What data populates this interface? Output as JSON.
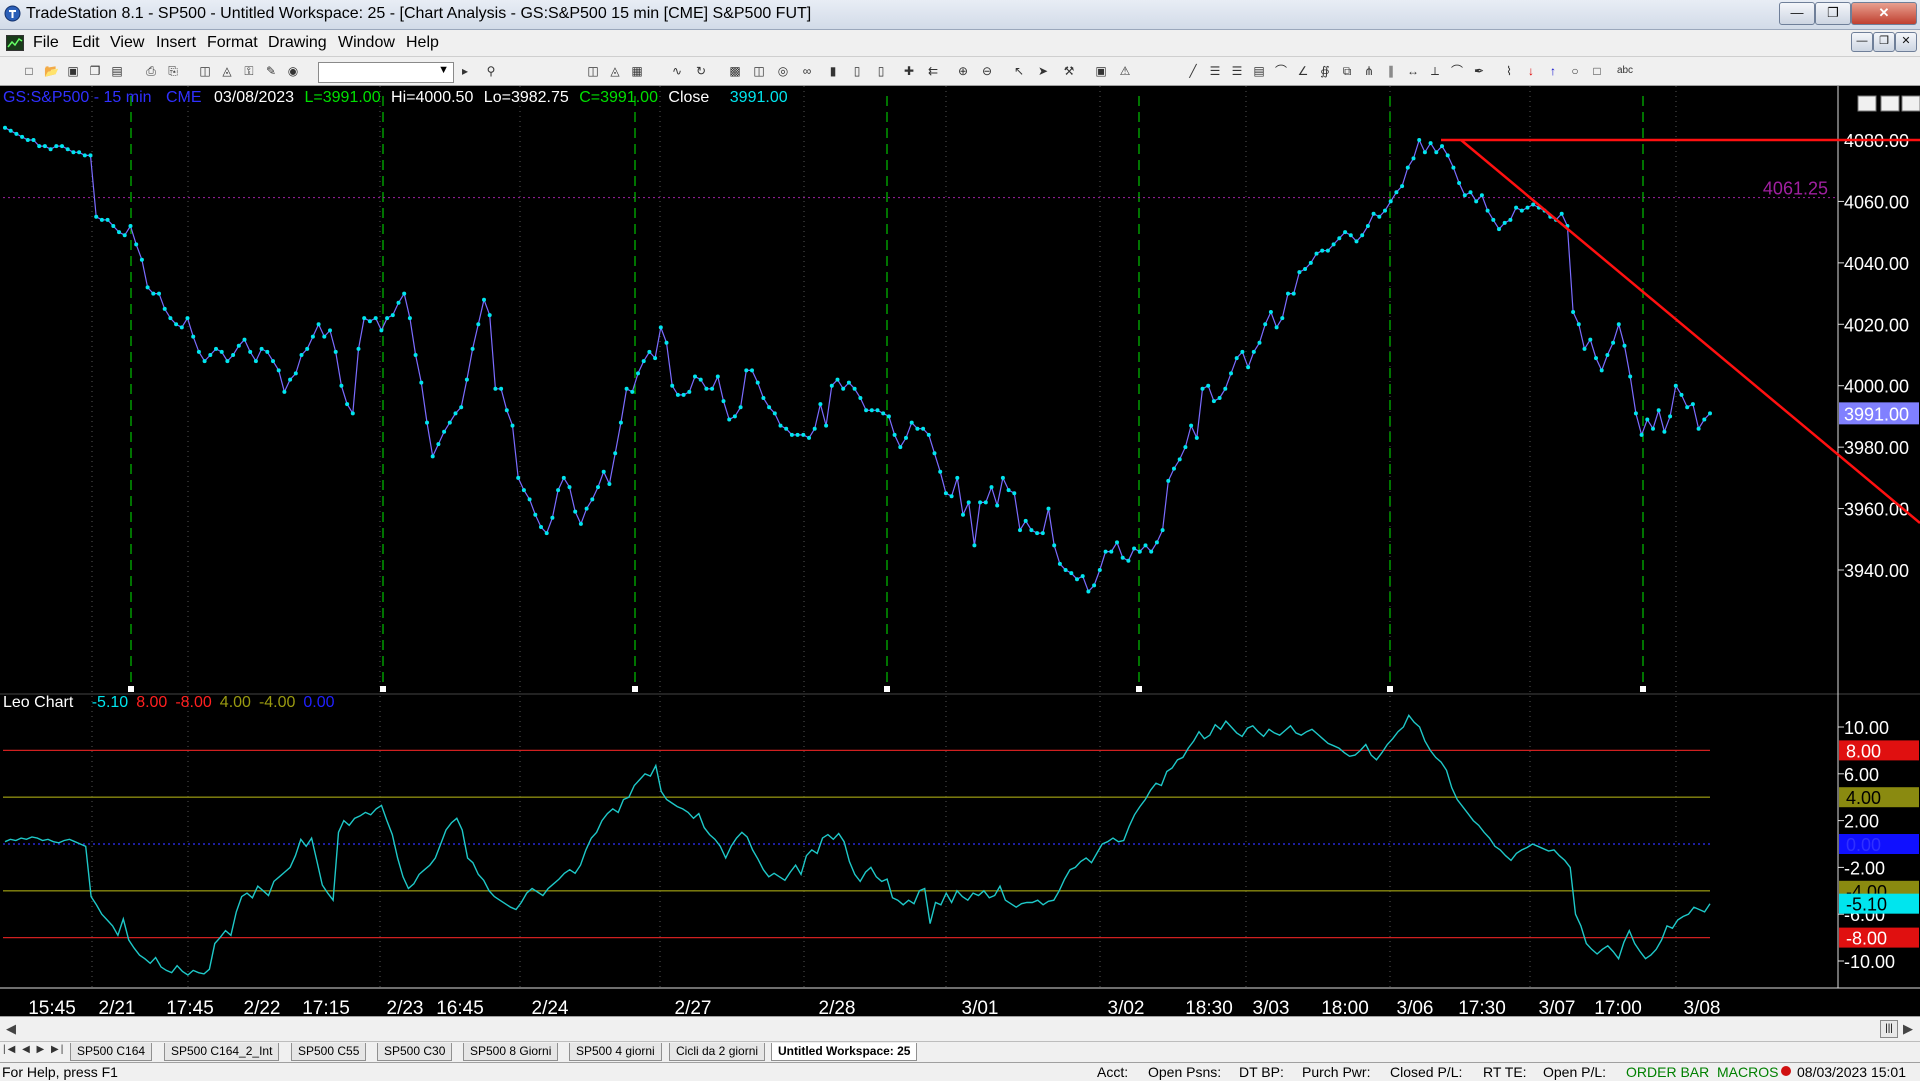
{
  "window": {
    "title": "TradeStation 8.1 - SP500 - Untitled Workspace:  25 - [Chart Analysis - GS:S&P500  15 min  [CME] S&P500 FUT]"
  },
  "menu": [
    "File",
    "Edit",
    "View",
    "Insert",
    "Format",
    "Drawing",
    "Window",
    "Help"
  ],
  "header": {
    "symbol": "GS:S&P500 - 15 min",
    "exchange": "CME",
    "date": "03/08/2023",
    "last": "L=3991.00",
    "high": "Hi=4000.50",
    "low": "Lo=3982.75",
    "close": "C=3991.00",
    "close_label": "Close",
    "close_value": "3991.00"
  },
  "indicator": {
    "name": "Leo Chart",
    "values": [
      {
        "text": "-5.10",
        "color": "#00e5ee"
      },
      {
        "text": "8.00",
        "color": "#ff2020"
      },
      {
        "text": "-8.00",
        "color": "#ff2020"
      },
      {
        "text": "4.00",
        "color": "#9a9a10"
      },
      {
        "text": "-4.00",
        "color": "#9a9a10"
      },
      {
        "text": "0.00",
        "color": "#2020ff"
      }
    ]
  },
  "colors": {
    "price_line": "#7b6cff",
    "price_dots": "#00e5ee",
    "trendline": "#ff1010",
    "session_lines": "#00c000",
    "osc_line": "#1ec8c8",
    "level_8": "#d02020",
    "level_4": "#8a8a10",
    "level_0": "#3030ff",
    "ref_level": "#a020a0"
  },
  "chart_data": [
    {
      "type": "line",
      "title": "GS:S&P500 - 15 min",
      "y_axis_ticks": [
        4080,
        4060,
        4040,
        4020,
        4000,
        3980,
        3960,
        3940
      ],
      "y_axis_labels": [
        "4080.00",
        "4060.00",
        "4040.00",
        "4020.00",
        "4000.00",
        "3980.00",
        "3960.00",
        "3940.00"
      ],
      "ylim": [
        3930,
        4090
      ],
      "x_axis_labels": [
        "15:45",
        "2/21",
        "17:45",
        "2/22",
        "17:15",
        "2/23",
        "16:45",
        "2/24",
        "2/27",
        "2/28",
        "3/01",
        "3/02",
        "18:30",
        "3/03",
        "18:00",
        "3/06",
        "17:30",
        "3/07",
        "17:00",
        "3/08"
      ],
      "reference_level": {
        "value": 4061.25,
        "label": "4061.25"
      },
      "last_value_label": "3991.00",
      "series": [
        {
          "values": [
            4084,
            4083,
            4082,
            4081,
            4080,
            4080,
            4078,
            4078,
            4077,
            4078,
            4078,
            4077,
            4076,
            4076,
            4075,
            4075,
            4055,
            4054,
            4054,
            4052,
            4050,
            4049,
            4052,
            4046,
            4041,
            4032,
            4030,
            4030,
            4025,
            4022,
            4020,
            4019,
            4022,
            4016,
            4011,
            4008,
            4010,
            4012,
            4011,
            4008,
            4010,
            4013,
            4015,
            4011,
            4008,
            4012,
            4011,
            4008,
            4005,
            3998,
            4002,
            4004,
            4010,
            4012,
            4016,
            4020,
            4016,
            4018,
            4011,
            4000,
            3994,
            3991,
            4012,
            4022,
            4021,
            4022,
            4018,
            4022,
            4023,
            4027,
            4030,
            4022,
            4010,
            4001,
            3988,
            3977,
            3981,
            3985,
            3988,
            3991,
            3993,
            4002,
            4012,
            4020,
            4028,
            4023,
            3999,
            3999,
            3992,
            3987,
            3970,
            3966,
            3963,
            3958,
            3954,
            3952,
            3957,
            3966,
            3970,
            3967,
            3959,
            3955,
            3960,
            3963,
            3967,
            3972,
            3968,
            3978,
            3988,
            3999,
            3998,
            4004,
            4008,
            4011,
            4009,
            4019,
            4014,
            4000,
            3997,
            3997,
            3998,
            4003,
            4002,
            3999,
            3999,
            4003,
            3995,
            3989,
            3990,
            3993,
            4005,
            4005,
            4001,
            3996,
            3993,
            3991,
            3987,
            3986,
            3984,
            3984,
            3984,
            3983,
            3986,
            3994,
            3987,
            4000,
            4002,
            3999,
            4001,
            3999,
            3996,
            3992,
            3992,
            3992,
            3991,
            3990,
            3984,
            3980,
            3983,
            3988,
            3986,
            3986,
            3984,
            3978,
            3972,
            3965,
            3964,
            3970,
            3958,
            3962,
            3948,
            3962,
            3962,
            3967,
            3961,
            3970,
            3966,
            3965,
            3953,
            3956,
            3953,
            3952,
            3952,
            3960,
            3948,
            3942,
            3940,
            3939,
            3937,
            3938,
            3933,
            3935,
            3940,
            3946,
            3946,
            3949,
            3944,
            3943,
            3947,
            3946,
            3948,
            3946,
            3949,
            3953,
            3969,
            3973,
            3976,
            3980,
            3987,
            3983,
            3999,
            4000,
            3995,
            3996,
            3999,
            4004,
            4009,
            4011,
            4006,
            4011,
            4014,
            4020,
            4024,
            4019,
            4022,
            4030,
            4030,
            4037,
            4038,
            4040,
            4043,
            4044,
            4044,
            4046,
            4048,
            4050,
            4049,
            4047,
            4049,
            4052,
            4056,
            4055,
            4057,
            4060,
            4063,
            4065,
            4071,
            4074,
            4080,
            4076,
            4079,
            4076,
            4078,
            4075,
            4071,
            4066,
            4062,
            4063,
            4060,
            4062,
            4057,
            4054,
            4051,
            4053,
            4054,
            4058,
            4057,
            4058,
            4059,
            4058,
            4057,
            4055,
            4054,
            4056,
            4052,
            4024,
            4020,
            4012,
            4015,
            4009,
            4005,
            4010,
            4014,
            4020,
            4013,
            4003,
            3991,
            3984,
            3989,
            3986,
            3992,
            3985,
            3990,
            4000,
            3997,
            3993,
            3994,
            3986,
            3989,
            3991
          ]
        }
      ]
    },
    {
      "type": "line",
      "title": "Leo Chart",
      "y_axis_ticks": [
        10,
        6,
        2,
        -2,
        -6,
        -10
      ],
      "y_axis_labels": [
        "10.00",
        "6.00",
        "2.00",
        "-2.00",
        "-6.00",
        "-10.00"
      ],
      "ylim": [
        -12,
        12
      ],
      "levels": [
        {
          "value": 8,
          "label": "8.00"
        },
        {
          "value": 4,
          "label": "4.00"
        },
        {
          "value": 0,
          "label": "0.00"
        },
        {
          "value": -4,
          "label": "-4.00"
        },
        {
          "value": -8,
          "label": "-8.00"
        }
      ],
      "last_value_label": "-5.10",
      "series": [
        {
          "values": [
            0.2,
            0.4,
            0.3,
            0.5,
            0.4,
            0.6,
            0.5,
            0.3,
            0.4,
            0.2,
            0.1,
            0.3,
            0.4,
            0.2,
            0.0,
            -0.2,
            -4.5,
            -5.2,
            -6.0,
            -6.5,
            -7.0,
            -7.8,
            -6.4,
            -8.2,
            -8.9,
            -9.5,
            -9.8,
            -10.2,
            -9.7,
            -10.5,
            -10.8,
            -11.0,
            -10.4,
            -10.9,
            -11.2,
            -10.8,
            -11.0,
            -11.1,
            -10.7,
            -8.5,
            -8.0,
            -7.4,
            -7.8,
            -5.8,
            -4.5,
            -4.2,
            -4.6,
            -3.6,
            -4.0,
            -4.4,
            -3.2,
            -2.8,
            -2.4,
            -2.0,
            -1.0,
            0.4,
            -0.2,
            0.5,
            -1.5,
            -3.5,
            -4.2,
            -4.8,
            1.0,
            2.0,
            1.6,
            2.2,
            2.4,
            2.7,
            2.5,
            3.0,
            3.3,
            2.0,
            0.8,
            -1.2,
            -2.8,
            -3.8,
            -3.4,
            -2.6,
            -2.2,
            -1.8,
            -1.2,
            0.0,
            1.2,
            1.8,
            2.2,
            1.2,
            -1.2,
            -1.6,
            -2.6,
            -3.1,
            -4.0,
            -4.5,
            -4.8,
            -5.1,
            -5.4,
            -5.6,
            -5.0,
            -4.2,
            -3.8,
            -4.1,
            -4.4,
            -3.8,
            -3.4,
            -3.0,
            -2.5,
            -2.2,
            -2.5,
            -1.8,
            -0.5,
            0.5,
            1.0,
            2.0,
            2.6,
            3.0,
            2.7,
            3.8,
            4.0,
            5.0,
            5.5,
            6.0,
            5.8,
            6.7,
            4.5,
            3.8,
            3.5,
            3.2,
            3.0,
            2.7,
            2.2,
            2.6,
            1.4,
            0.8,
            0.4,
            -0.2,
            -1.2,
            -0.2,
            0.5,
            1.0,
            0.6,
            -0.5,
            -1.3,
            -2.2,
            -2.8,
            -2.5,
            -2.8,
            -3.1,
            -2.4,
            -1.8,
            -2.6,
            -1.0,
            -0.5,
            -0.8,
            0.5,
            0.8,
            0.4,
            0.9,
            0.2,
            -1.5,
            -2.6,
            -3.2,
            -2.4,
            -2.0,
            -2.8,
            -3.2,
            -3.0,
            -4.6,
            -4.8,
            -5.2,
            -4.8,
            -5.1,
            -4.0,
            -3.8,
            -6.8,
            -5.0,
            -5.2,
            -4.2,
            -5.0,
            -4.0,
            -4.5,
            -4.8,
            -4.2,
            -4.4,
            -4.0,
            -4.6,
            -4.4,
            -3.6,
            -4.8,
            -5.1,
            -5.4,
            -5.1,
            -5.0,
            -5.0,
            -4.8,
            -5.2,
            -4.9,
            -4.8,
            -4.0,
            -3.0,
            -2.2,
            -2.0,
            -1.5,
            -1.2,
            -1.6,
            -0.8,
            0.0,
            0.2,
            0.5,
            0.2,
            0.3,
            1.5,
            2.5,
            3.2,
            3.8,
            4.6,
            5.2,
            5.0,
            6.2,
            6.5,
            7.2,
            7.4,
            8.2,
            8.8,
            9.6,
            9.0,
            9.3,
            10.2,
            9.8,
            10.5,
            10.0,
            9.5,
            9.2,
            9.9,
            10.1,
            9.6,
            9.2,
            9.8,
            9.5,
            9.3,
            9.7,
            10.1,
            9.5,
            9.3,
            9.6,
            9.8,
            9.4,
            9.0,
            8.6,
            8.4,
            8.2,
            7.8,
            7.5,
            7.6,
            8.0,
            8.5,
            7.6,
            7.2,
            7.8,
            8.5,
            9.0,
            9.6,
            10.0,
            11.0,
            10.4,
            10.0,
            8.8,
            8.0,
            7.4,
            7.0,
            6.3,
            4.8,
            3.8,
            3.2,
            2.6,
            2.0,
            1.6,
            1.0,
            0.5,
            -0.2,
            -0.5,
            -1.0,
            -1.4,
            -0.8,
            -0.5,
            -0.3,
            0.0,
            -0.2,
            -0.4,
            -0.6,
            -0.5,
            -1.0,
            -1.4,
            -2.0,
            -6.0,
            -7.0,
            -8.5,
            -9.0,
            -9.4,
            -9.0,
            -8.7,
            -9.2,
            -9.8,
            -8.4,
            -7.4,
            -8.5,
            -9.2,
            -9.8,
            -9.5,
            -9.0,
            -8.2,
            -7.0,
            -7.2,
            -6.5,
            -6.2,
            -6.0,
            -5.4,
            -5.6,
            -5.8,
            -5.1
          ]
        }
      ]
    }
  ],
  "tabs": [
    "SP500 C164",
    "SP500 C164_2_Int",
    "SP500 C55",
    "SP500 C30",
    "SP500 8 Giorni",
    "SP500 4 giorni",
    "Cicli da 2 giorni",
    "Untitled Workspace:  25"
  ],
  "status": {
    "help": "For Help, press F1",
    "acct": "Acct:",
    "open_psns": "Open Psns:",
    "dt_bp": "DT BP:",
    "purch_pwr": "Purch Pwr:",
    "closed_pl": "Closed P/L:",
    "rt_te": "RT TE:",
    "open_pl": "Open P/L:",
    "order_bar": "ORDER BAR",
    "macros": "MACROS",
    "datetime": "08/03/2023 15:01"
  }
}
